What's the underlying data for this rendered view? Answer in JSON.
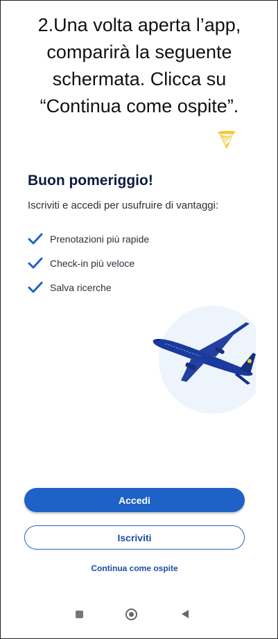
{
  "instruction": {
    "line1": "2.Una volta aperta l’app,",
    "line2": "comparirà la seguente",
    "line3": "schermata. Clicca su",
    "line4": "“Continua come ospite”."
  },
  "brand": {
    "logo_icon": "harp-logo-icon",
    "color": "#f1c933"
  },
  "welcome": {
    "greeting": "Buon pomeriggio!",
    "subtitle": "Iscriviti e accedi per usufruire di vantaggi:"
  },
  "benefits": [
    {
      "icon": "check-icon",
      "label": "Prenotazioni più rapide"
    },
    {
      "icon": "check-icon",
      "label": "Check-in più veloce"
    },
    {
      "icon": "check-icon",
      "label": "Salva ricerche"
    }
  ],
  "illustration": {
    "icon": "airplane-icon"
  },
  "actions": {
    "login_label": "Accedi",
    "register_label": "Iscriviti",
    "guest_label": "Continua come ospite"
  },
  "navigation": {
    "recent_icon": "square-icon",
    "home_icon": "circle-icon",
    "back_icon": "triangle-back-icon"
  },
  "colors": {
    "primary": "#1f62c7",
    "heading": "#0d1b3e",
    "check": "#1f62c7",
    "illustration_bg": "#eef4fb",
    "plane": "#1b3a9e"
  }
}
